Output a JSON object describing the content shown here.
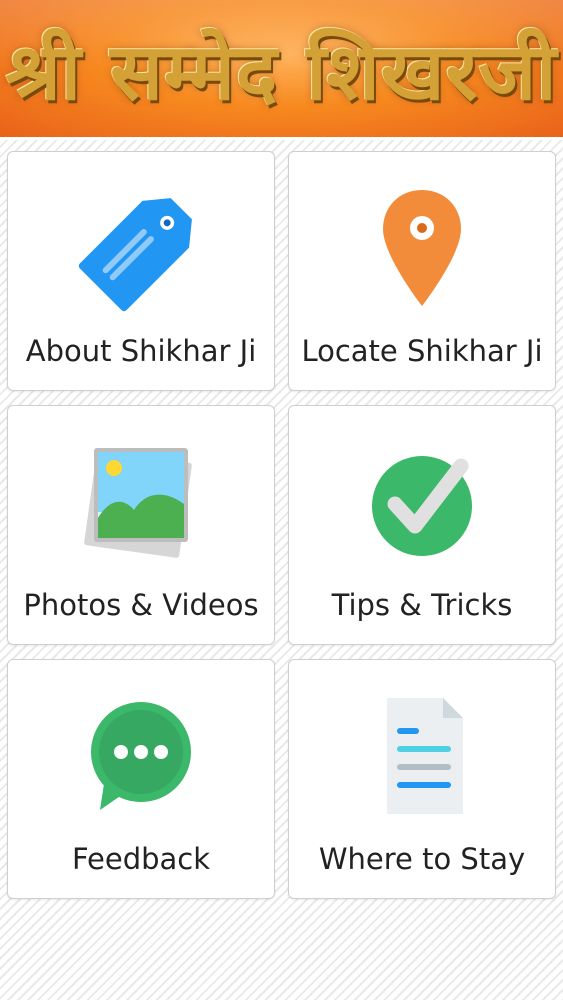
{
  "header": {
    "title": "श्री सम्मेद शिखरजी"
  },
  "menu": [
    {
      "label": "About Shikhar Ji",
      "icon": "tag-icon",
      "color": "#2196f3"
    },
    {
      "label": "Locate Shikhar Ji",
      "icon": "location-pin-icon",
      "color": "#f28c3b"
    },
    {
      "label": "Photos & Videos",
      "icon": "photo-gallery-icon",
      "color": "#4fc3f7"
    },
    {
      "label": "Tips & Tricks",
      "icon": "check-circle-icon",
      "color": "#3bb86a"
    },
    {
      "label": "Feedback",
      "icon": "chat-bubble-icon",
      "color": "#3bb86a"
    },
    {
      "label": "Where to Stay",
      "icon": "document-icon",
      "color": "#2196f3"
    }
  ]
}
